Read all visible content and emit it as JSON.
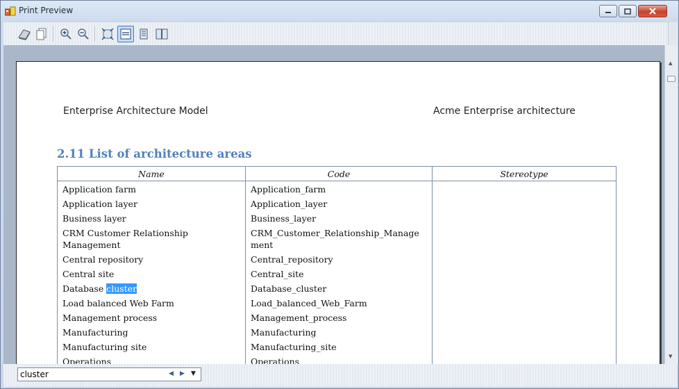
{
  "window": {
    "title": "Print Preview"
  },
  "toolbar": {
    "buttons": [
      {
        "name": "print-icon"
      },
      {
        "name": "page-setup-icon"
      },
      {
        "name": "zoom-in-icon"
      },
      {
        "name": "zoom-out-icon"
      },
      {
        "name": "fit-page-icon"
      },
      {
        "name": "fit-width-icon",
        "active": true
      },
      {
        "name": "single-page-icon"
      },
      {
        "name": "two-pages-icon"
      }
    ]
  },
  "page": {
    "header_left": "Enterprise Architecture Model",
    "header_right": "Acme Enterprise architecture",
    "section_title": "2.11 List of architecture areas",
    "table": {
      "columns": [
        "Name",
        "Code",
        "Stereotype"
      ],
      "rows": [
        {
          "name": "Application farm",
          "code": "Application_farm"
        },
        {
          "name": "Application layer",
          "code": "Application_layer"
        },
        {
          "name": "Business layer",
          "code": "Business_layer"
        },
        {
          "name": "CRM Customer Relationship Management",
          "code": "CRM_Customer_Relationship_Management"
        },
        {
          "name": "Central repository",
          "code": "Central_repository"
        },
        {
          "name": "Central site",
          "code": "Central_site"
        },
        {
          "name_prefix": "Database ",
          "name_highlight": "cluster",
          "code": "Database_cluster"
        },
        {
          "name": "Load balanced Web Farm",
          "code": "Load_balanced_Web_Farm"
        },
        {
          "name": "Management process",
          "code": "Management_process"
        },
        {
          "name": "Manufacturing",
          "code": "Manufacturing"
        },
        {
          "name": "Manufacturing site",
          "code": "Manufacturing_site"
        },
        {
          "name": "Operations",
          "code": "Operations"
        }
      ]
    }
  },
  "find": {
    "value": "cluster"
  },
  "colors": {
    "accent": "#4f81bd",
    "highlight": "#3399ff"
  }
}
